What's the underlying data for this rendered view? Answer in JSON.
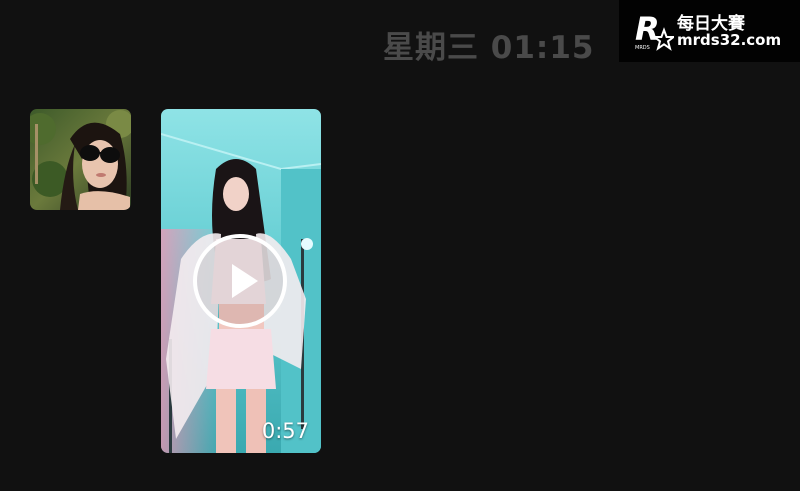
{
  "chat": {
    "timestamp": "星期三 01:15",
    "avatar": {
      "icon": "user-photo"
    },
    "video_message": {
      "duration": "0:57",
      "icon": "play-icon"
    }
  },
  "watermark": {
    "logo_letter": "R",
    "logo_small_text": "MRDS",
    "title": "每日大賽",
    "url": "mrds32.com"
  },
  "colors": {
    "background": "#111111",
    "timestamp": "#4a4a4a",
    "video_tint": "#6fd6d8",
    "watermark_text": "#ffffff"
  }
}
